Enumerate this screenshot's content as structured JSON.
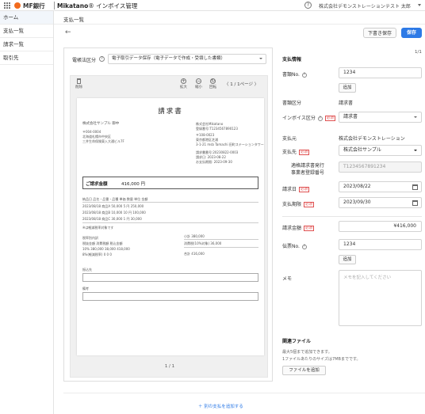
{
  "header": {
    "brand": "MF銀行",
    "app_name": "Mikatano",
    "app_suffix": "インボイス管理",
    "company": "株式会社デモンストレーション",
    "user": "テスト 太郎"
  },
  "sidebar": {
    "items": [
      {
        "label": "ホーム",
        "active": true
      },
      {
        "label": "支払一覧",
        "active": false
      },
      {
        "label": "請求一覧",
        "active": false
      },
      {
        "label": "取引先",
        "active": false
      }
    ]
  },
  "page": {
    "title": "支払一覧",
    "draft_button": "下書き保存",
    "save_button": "保存",
    "page_counter": "1/1",
    "add_payment_link": "＋ 別の支払を追加する"
  },
  "left_panel": {
    "ebook_label": "電帳法区分",
    "ebook_value": "電子取引データ保存（電子データで作成・受領した書類）",
    "viewer": {
      "delete": "削除",
      "zoom_in": "拡大",
      "zoom_out": "縮小",
      "rotate": "回転",
      "pager": "〈  1 / 1ページ  〉",
      "page_footer": "1 / 1"
    },
    "document": {
      "title": "請求書",
      "to_company": "株式会社サンプル 御中",
      "to_zip": "〒004-0004",
      "to_addr1": "北海道札幌市中央区",
      "to_addr2": "三井生命保険東入大通ビル7F",
      "from_company": "株式会社Mikatano",
      "from_reg": "登録番号:T1234567890123",
      "from_zip": "〒108-0023",
      "from_addr1": "東京都港区芝浦",
      "from_addr2": "3-1-21 msb Tamachi 田町ステーションタワー",
      "invoice_no": "請求書番号:20230822-0003",
      "issue_date": "請求日:  2023-08-22",
      "due_date": "お支払期限:  2023-09-30",
      "amount_label": "ご請求金額",
      "amount_value": "416,000 円",
      "table_header": "納品日     品名・品番・品種        単価       数量    単位       金額",
      "row1": "2023/08/18   商品A             50,000     5  円      250,000",
      "row2": "2023/08/18   商品B             10,000     10  円      100,000",
      "row3": "2023/08/18   商品C             30,000     1  円       30,000",
      "tax_note": "※は軽減税率対象です",
      "breakdown_title": "税率別内訳",
      "breakdown_header": "             税抜金額     消費税額     税込金額",
      "breakdown_row1": "10%          380,000      38,000     418,000",
      "breakdown_row2": "8%(軽減税率)         0          0          0",
      "subtotal": "小計                               380,000",
      "tax": "消費税(10%対象)                       36,000",
      "total": "合計                               416,000",
      "remarks_label": "振込先",
      "notes_label": "備考"
    }
  },
  "form": {
    "section_title": "支払情報",
    "doc_no_label": "書類No.",
    "doc_no_value": "1234",
    "add_button": "追加",
    "doc_type_label": "書類区分",
    "doc_type_value": "請求書",
    "invoice_type_label": "インボイス区分",
    "invoice_type_value": "請求書",
    "payer_label": "支払元",
    "payer_value": "株式会社デモンストレーション",
    "payee_label": "支払先",
    "payee_value": "株式会社サンプル",
    "reg_label_line1": "適格請求書発行",
    "reg_label_line2": "事業者登録番号",
    "reg_value": "T1234567891234",
    "invoice_date_label": "請求日",
    "invoice_date_value": "2023/08/22",
    "due_date_label": "支払期限",
    "due_date_value": "2023/09/30",
    "amount_label": "請求金額",
    "amount_value": "¥416,000",
    "slip_no_label": "伝票No.",
    "slip_no_value": "1234",
    "slip_add_button": "追加",
    "memo_label": "メモ",
    "memo_placeholder": "メモを記入してください",
    "files_title": "関連ファイル",
    "files_note1": "最大5個まで追加できます。",
    "files_note2": "1ファイルあたりのサイズは7MBまでです。",
    "files_button": "ファイルを追加",
    "required": "必須"
  },
  "colors": {
    "accent": "#2d7ae6",
    "brand_orange": "#f26b1d",
    "required_red": "#e05050"
  }
}
